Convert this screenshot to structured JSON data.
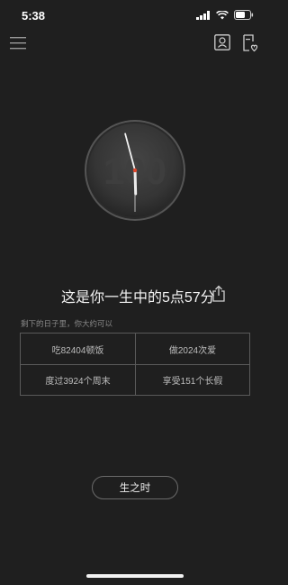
{
  "status_bar": {
    "time": "5:38",
    "icons": [
      "signal-icon",
      "wifi-icon",
      "battery-icon"
    ]
  },
  "top_bar": {
    "icons": [
      "menu-icon",
      "profile-icon",
      "record-icon"
    ]
  },
  "clock": {
    "watermark": "100",
    "hour": 5,
    "minute": 57,
    "second": 30,
    "colors": {
      "face": "#3a3a3a",
      "hands": "#f2f2f2",
      "center": "#e0452a"
    }
  },
  "main": {
    "headline": "这是你一生中的5点57分",
    "share_icon": "share-icon",
    "sub_label": "剩下的日子里，你大约可以",
    "stats": [
      {
        "text": "吃82404顿饭"
      },
      {
        "text": "做2024次爱"
      },
      {
        "text": "度过3924个周末"
      },
      {
        "text": "享受151个长假"
      }
    ]
  },
  "bottom": {
    "button_label": "生之时"
  }
}
